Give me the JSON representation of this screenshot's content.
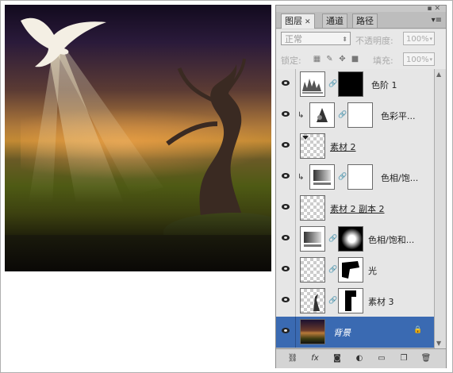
{
  "panel": {
    "tabs": [
      {
        "label": "图层",
        "active": true
      },
      {
        "label": "通道",
        "active": false
      },
      {
        "label": "路径",
        "active": false
      }
    ],
    "blend_mode": "正常",
    "opacity_label": "不透明度:",
    "opacity_value": "100%",
    "lock_label": "锁定:",
    "fill_label": "填充:",
    "fill_value": "100%"
  },
  "layers": [
    {
      "name": "色阶 1",
      "type": "adjustment-levels",
      "mask": "black",
      "clipped": false,
      "underlined": false
    },
    {
      "name": "色彩平...",
      "type": "adjustment-color-balance",
      "mask": "white",
      "clipped": true,
      "underlined": false
    },
    {
      "name": "素材 2",
      "type": "pixel",
      "clipped": false,
      "underlined": true
    },
    {
      "name": "色相/饱...",
      "type": "adjustment-hue-sat",
      "mask": "white",
      "clipped": true,
      "underlined": false
    },
    {
      "name": "素材 2 副本 2",
      "type": "pixel",
      "clipped": false,
      "underlined": true
    },
    {
      "name": "色相/饱和...",
      "type": "adjustment-hue-sat",
      "mask": "mask",
      "clipped": false,
      "underlined": false
    },
    {
      "name": "光",
      "type": "pixel",
      "mask": "mask",
      "clipped": false,
      "underlined": false
    },
    {
      "name": "素材 3",
      "type": "pixel",
      "mask": "mask",
      "clipped": false,
      "underlined": false
    },
    {
      "name": "背景",
      "type": "background",
      "clipped": false,
      "underlined": false,
      "selected": true,
      "locked": true
    }
  ],
  "colors": {
    "selection": "#3a6ab2",
    "panel_bg": "#d4d4d4"
  }
}
